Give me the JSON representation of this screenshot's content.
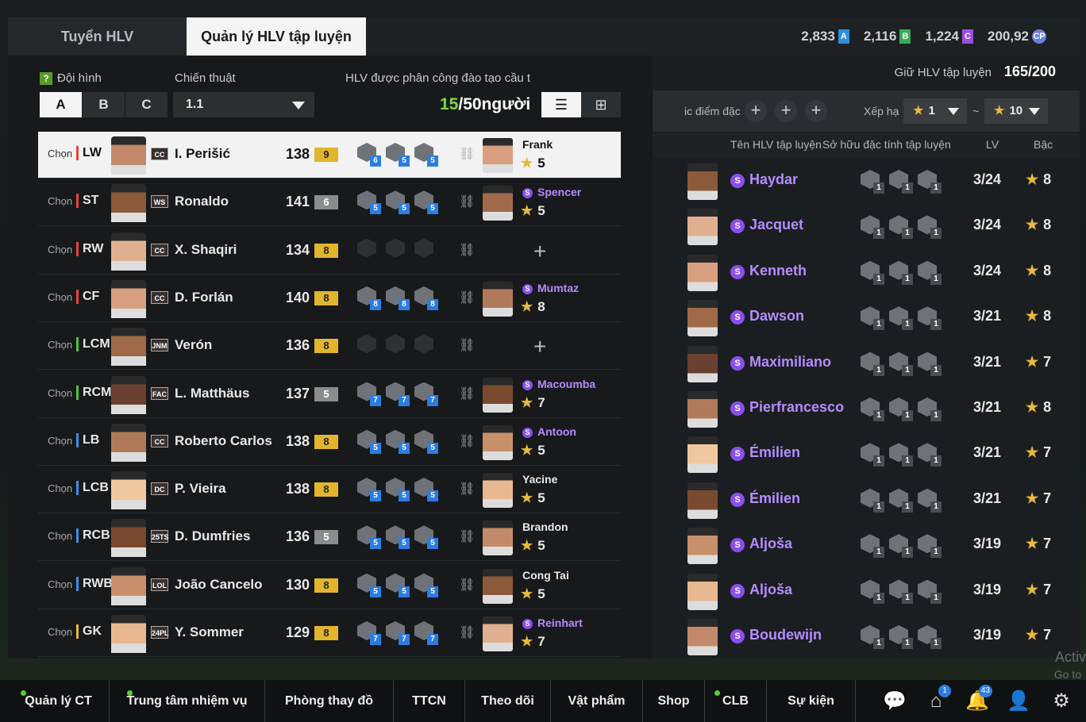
{
  "tabs": {
    "recruit": "Tuyển HLV",
    "manage": "Quản lý HLV tập luyện"
  },
  "currencies": [
    {
      "value": "2,833",
      "badge": "A",
      "color": "#2d8fe0"
    },
    {
      "value": "2,116",
      "badge": "B",
      "color": "#3aaa5a"
    },
    {
      "value": "1,224",
      "badge": "C",
      "color": "#9a4ee0"
    },
    {
      "value": "200,92",
      "badge": "CP",
      "color": "#6a7fe0"
    }
  ],
  "left": {
    "formation_label": "Đội hình",
    "tactic_label": "Chiến thuật",
    "assign_label": "HLV được phân công đào tạo cầu t",
    "formations": [
      "A",
      "B",
      "C"
    ],
    "tactic_value": "1.1",
    "count_current": "15",
    "count_rest": "/50người",
    "chon": "Chọn",
    "players": [
      {
        "pos": "LW",
        "group": "att",
        "season": "CC",
        "name": "I. Perišić",
        "ovr": "138",
        "lvl": "9",
        "lvl_color": "gold",
        "traits": [
          "6",
          "5",
          "5"
        ],
        "coach": "Frank",
        "special": false,
        "stars": "5",
        "selected": true
      },
      {
        "pos": "ST",
        "group": "att",
        "season": "WS",
        "name": "Ronaldo",
        "ovr": "141",
        "lvl": "6",
        "lvl_color": "grey",
        "traits": [
          "5",
          "5",
          "5"
        ],
        "coach": "Spencer",
        "special": true,
        "stars": "5"
      },
      {
        "pos": "RW",
        "group": "att",
        "season": "CC",
        "name": "X. Shaqiri",
        "ovr": "134",
        "lvl": "8",
        "lvl_color": "gold",
        "traits": [],
        "coach": "",
        "special": false,
        "stars": ""
      },
      {
        "pos": "CF",
        "group": "att",
        "season": "CC",
        "name": "D. Forlán",
        "ovr": "140",
        "lvl": "8",
        "lvl_color": "gold",
        "traits": [
          "8",
          "8",
          "8"
        ],
        "coach": "Mumtaz",
        "special": true,
        "stars": "8"
      },
      {
        "pos": "LCM",
        "group": "mid",
        "season": "JNM",
        "name": "Verón",
        "ovr": "136",
        "lvl": "8",
        "lvl_color": "gold",
        "traits": [],
        "coach": "",
        "special": false,
        "stars": ""
      },
      {
        "pos": "RCM",
        "group": "mid",
        "season": "FAC",
        "name": "L. Matthäus",
        "ovr": "137",
        "lvl": "5",
        "lvl_color": "grey",
        "traits": [
          "7",
          "7",
          "7"
        ],
        "coach": "Macoumba",
        "special": true,
        "stars": "7"
      },
      {
        "pos": "LB",
        "group": "def",
        "season": "CC",
        "name": "Roberto Carlos",
        "ovr": "138",
        "lvl": "8",
        "lvl_color": "gold",
        "traits": [
          "5",
          "5",
          "5"
        ],
        "coach": "Antoon",
        "special": true,
        "stars": "5"
      },
      {
        "pos": "LCB",
        "group": "def",
        "season": "DC",
        "name": "P. Vieira",
        "ovr": "138",
        "lvl": "8",
        "lvl_color": "gold",
        "traits": [
          "5",
          "5",
          "5"
        ],
        "coach": "Yacine",
        "special": false,
        "stars": "5"
      },
      {
        "pos": "RCB",
        "group": "def",
        "season": "25TS",
        "name": "D. Dumfries",
        "ovr": "136",
        "lvl": "5",
        "lvl_color": "grey",
        "traits": [
          "5",
          "5",
          "5"
        ],
        "coach": "Brandon",
        "special": false,
        "stars": "5"
      },
      {
        "pos": "RWB",
        "group": "def",
        "season": "LOL",
        "name": "João Cancelo",
        "ovr": "130",
        "lvl": "8",
        "lvl_color": "gold",
        "traits": [
          "5",
          "5",
          "5"
        ],
        "coach": "Cong Tai",
        "special": false,
        "stars": "5"
      },
      {
        "pos": "GK",
        "group": "gk",
        "season": "24PL",
        "name": "Y. Sommer",
        "ovr": "129",
        "lvl": "8",
        "lvl_color": "gold",
        "traits": [
          "7",
          "7",
          "7"
        ],
        "coach": "Reinhart",
        "special": true,
        "stars": "7"
      }
    ]
  },
  "right": {
    "title": "Giữ HLV tập luyện",
    "capacity": "165/200",
    "filter_label": "ic điểm đặc",
    "sort_label": "Xếp hạ",
    "star_min": "1",
    "star_max": "10",
    "tilde": "~",
    "headers": {
      "name": "Tên HLV tập luyện",
      "traits": "Sở hữu đặc tính tập luyện",
      "lv": "LV",
      "bac": "Bậc"
    },
    "coaches": [
      {
        "name": "Haydar",
        "lv": "3/24",
        "bac": "8"
      },
      {
        "name": "Jacquet",
        "lv": "3/24",
        "bac": "8"
      },
      {
        "name": "Kenneth",
        "lv": "3/24",
        "bac": "8"
      },
      {
        "name": "Dawson",
        "lv": "3/21",
        "bac": "8"
      },
      {
        "name": "Maximiliano",
        "lv": "3/21",
        "bac": "7"
      },
      {
        "name": "Pierfrancesco",
        "lv": "3/21",
        "bac": "8"
      },
      {
        "name": "Émilien",
        "lv": "3/21",
        "bac": "7"
      },
      {
        "name": "Émilien",
        "lv": "3/21",
        "bac": "7"
      },
      {
        "name": "Aljoša",
        "lv": "3/19",
        "bac": "7"
      },
      {
        "name": "Aljoša",
        "lv": "3/19",
        "bac": "7"
      },
      {
        "name": "Boudewijn",
        "lv": "3/19",
        "bac": "7"
      }
    ],
    "trait_num": "1",
    "s_badge": "S"
  },
  "nav": [
    {
      "label": "Quản lý CT",
      "dot": true
    },
    {
      "label": "Trung tâm nhiệm vụ",
      "dot": true
    },
    {
      "label": "Phòng thay đồ",
      "dot": false
    },
    {
      "label": "TTCN",
      "dot": false
    },
    {
      "label": "Theo dõi",
      "dot": false
    },
    {
      "label": "Vật phẩm",
      "dot": false
    },
    {
      "label": "Shop",
      "dot": false
    },
    {
      "label": "CLB",
      "dot": true
    },
    {
      "label": "Sự kiện",
      "dot": false
    }
  ],
  "nav_badges": {
    "home": "1",
    "bell": "43"
  },
  "watermark": {
    "line1": "Activ",
    "line2": "Go to"
  }
}
